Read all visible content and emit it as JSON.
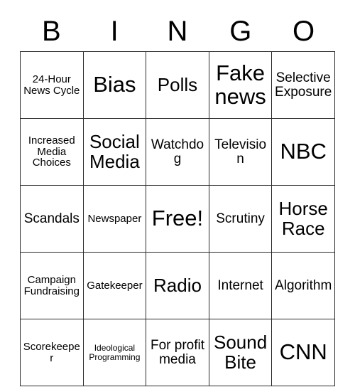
{
  "card": {
    "header_letters": [
      "B",
      "I",
      "N",
      "G",
      "O"
    ],
    "rows": [
      [
        {
          "text": "24-Hour News Cycle",
          "size": "sm"
        },
        {
          "text": "Bias",
          "size": "xl"
        },
        {
          "text": "Polls",
          "size": "lg"
        },
        {
          "text": "Fake news",
          "size": "xl"
        },
        {
          "text": "Selective Exposure",
          "size": "md"
        }
      ],
      [
        {
          "text": "Increased Media Choices",
          "size": "sm"
        },
        {
          "text": "Social Media",
          "size": "lg"
        },
        {
          "text": "Watchdog",
          "size": "md"
        },
        {
          "text": "Television",
          "size": "md"
        },
        {
          "text": "NBC",
          "size": "xl"
        }
      ],
      [
        {
          "text": "Scandals",
          "size": "md"
        },
        {
          "text": "Newspaper",
          "size": "sm"
        },
        {
          "text": "Free!",
          "size": "xl"
        },
        {
          "text": "Scrutiny",
          "size": "md"
        },
        {
          "text": "Horse Race",
          "size": "lg"
        }
      ],
      [
        {
          "text": "Campaign Fundraising",
          "size": "sm"
        },
        {
          "text": "Gatekeeper",
          "size": "sm"
        },
        {
          "text": "Radio",
          "size": "lg"
        },
        {
          "text": "Internet",
          "size": "md"
        },
        {
          "text": "Algorithm",
          "size": "md"
        }
      ],
      [
        {
          "text": "Scorekeeper",
          "size": "sm"
        },
        {
          "text": "Ideological Programming",
          "size": "xs"
        },
        {
          "text": "For profit media",
          "size": "md"
        },
        {
          "text": "Sound Bite",
          "size": "lg"
        },
        {
          "text": "CNN",
          "size": "xl"
        }
      ]
    ],
    "free_space": "Free!",
    "colors": {
      "border": "#2b2b2b",
      "cell_background": "#ffffff",
      "text": "#000000",
      "page_background": "#ffffff"
    }
  }
}
